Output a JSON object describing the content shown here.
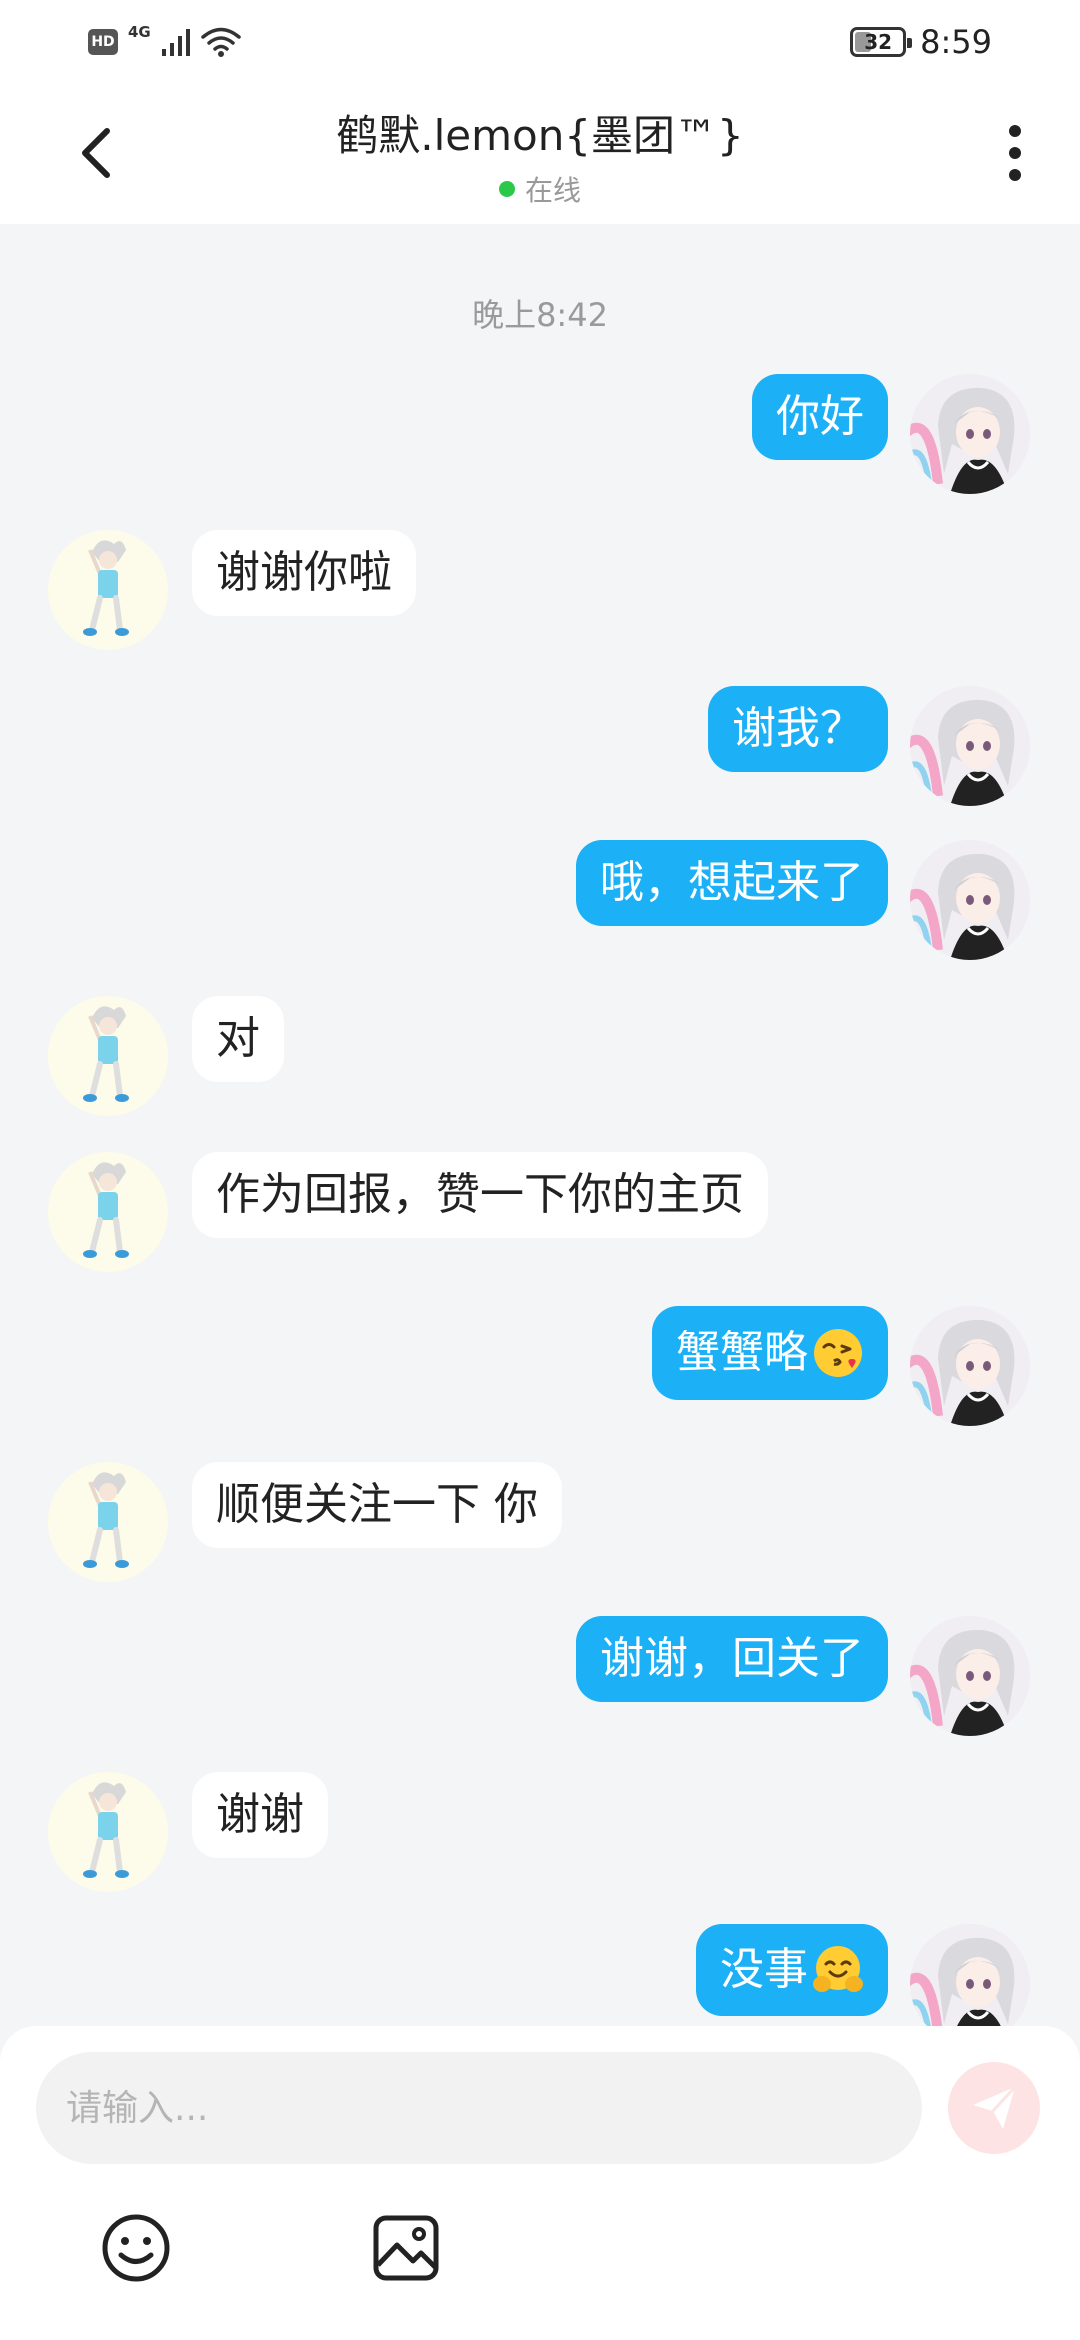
{
  "status_bar": {
    "hd": "HD",
    "network": "4G",
    "battery": "32",
    "time": "8:59"
  },
  "header": {
    "title": "鹤默.lemon{墨团™}",
    "status": "在线"
  },
  "chat": {
    "timestamp": "晚上8:42",
    "messages": [
      {
        "side": "mine",
        "text": "你好"
      },
      {
        "side": "theirs",
        "text": "谢谢你啦"
      },
      {
        "side": "mine",
        "text": "谢我？"
      },
      {
        "side": "mine",
        "text": "哦，想起来了"
      },
      {
        "side": "theirs",
        "text": "对"
      },
      {
        "side": "theirs",
        "text": "作为回报，赞一下你的主页"
      },
      {
        "side": "mine",
        "text": "蟹蟹略",
        "emoji": "face-blowing-kiss"
      },
      {
        "side": "theirs",
        "text": "顺便关注一下 你"
      },
      {
        "side": "mine",
        "text": "谢谢，回关了"
      },
      {
        "side": "theirs",
        "text": "谢谢"
      },
      {
        "side": "mine",
        "text": "没事",
        "emoji": "hugging-face"
      }
    ]
  },
  "input": {
    "placeholder": "请输入..."
  },
  "colors": {
    "accent": "#1cb0f6",
    "online": "#2bc94a",
    "send_button": "#fde3e3"
  },
  "icons": [
    "back-icon",
    "more-icon",
    "send-icon",
    "emoji-icon",
    "image-icon"
  ]
}
